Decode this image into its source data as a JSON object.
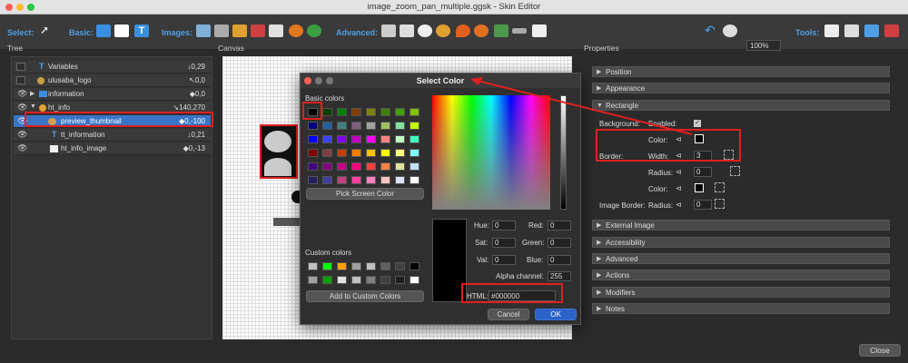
{
  "window": {
    "title": "image_zoom_pan_multiple.ggsk - Skin Editor"
  },
  "toolbar": {
    "select": "Select:",
    "basic": "Basic:",
    "images": "Images:",
    "advanced": "Advanced:",
    "tools": "Tools:",
    "zoom": "100%"
  },
  "panels": {
    "tree": "Tree",
    "canvas": "Canvas",
    "properties": "Properties"
  },
  "tree": {
    "rows": [
      {
        "label": "Variables",
        "value": "↓0,29"
      },
      {
        "label": "ulusaba_logo",
        "value": "↖0,0"
      },
      {
        "label": "information",
        "value": "◆0,0"
      },
      {
        "label": "ht_info",
        "value": "↘140,270"
      },
      {
        "label": "preview_thumbnail",
        "value": "◆0,-100"
      },
      {
        "label": "tt_information",
        "value": "↓0,21"
      },
      {
        "label": "ht_info_image",
        "value": "◆0,-13"
      }
    ]
  },
  "dialog": {
    "title": "Select Color",
    "basic_colors": "Basic colors",
    "pick_screen": "Pick Screen Color",
    "custom_colors": "Custom colors",
    "add_custom": "Add to Custom Colors",
    "hue_l": "Hue:",
    "hue": "0",
    "red_l": "Red:",
    "red": "0",
    "sat_l": "Sat:",
    "sat": "0",
    "green_l": "Green:",
    "green": "0",
    "val_l": "Val:",
    "val": "0",
    "blue_l": "Blue:",
    "blue": "0",
    "alpha_l": "Alpha channel:",
    "alpha": "255",
    "html_l": "HTML:",
    "html": "#000000",
    "cancel": "Cancel",
    "ok": "OK"
  },
  "properties": {
    "sections": [
      "Position",
      "Appearance",
      "Rectangle",
      "External Image",
      "Accessibility",
      "Advanced",
      "Actions",
      "Modifiers",
      "Notes"
    ],
    "background": "Background:",
    "enabled": "Enabled:",
    "color": "Color:",
    "border": "Border:",
    "width": "Width:",
    "width_val": "3",
    "radius": "Radius:",
    "radius_val": "0",
    "color2": "Color:",
    "image_border": "Image Border:",
    "radius2": "Radius:",
    "radius2_val": "0"
  },
  "close": "Close"
}
